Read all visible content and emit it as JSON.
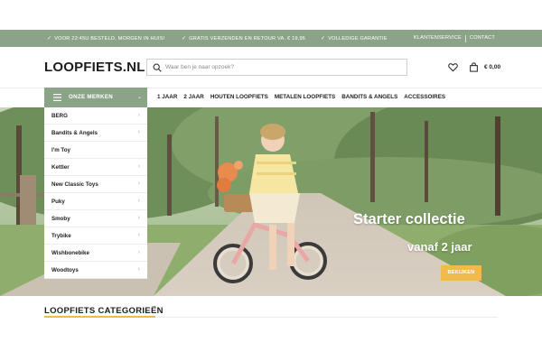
{
  "topbar": {
    "usps": [
      "VOOR 22:45U BESTELD, MORGEN IN HUIS!",
      "GRATIS VERZENDEN EN RETOUR VA. € 19,95",
      "VOLLEDIGE GARANTIE"
    ],
    "links": [
      "KLANTENSERVICE",
      "CONTACT"
    ],
    "color": "#8ba488"
  },
  "header": {
    "logo": "LOOPFIETS.NL",
    "search_placeholder": "Waar ben je naar opzoek?",
    "cart_total": "€ 0,00"
  },
  "nav": {
    "brands_label": "ONZE MERKEN",
    "items": [
      "1 JAAR",
      "2 JAAR",
      "HOUTEN LOOPFIETS",
      "METALEN LOOPFIETS",
      "BANDITS & ANGELS",
      "ACCESSOIRES"
    ]
  },
  "brands": [
    "BERG",
    "Bandits & Angels",
    "I'm Toy",
    "Kettler",
    "New Classic Toys",
    "Puky",
    "Smoby",
    "Trybike",
    "Wishbonebike",
    "Woodtoys"
  ],
  "hero": {
    "title": "Starter collectie",
    "subtitle": "vanaf 2 jaar",
    "button": "BEKIJKEN",
    "button_color": "#f2b94b"
  },
  "section": {
    "title": "LOOPFIETS CATEGORIEËN"
  }
}
